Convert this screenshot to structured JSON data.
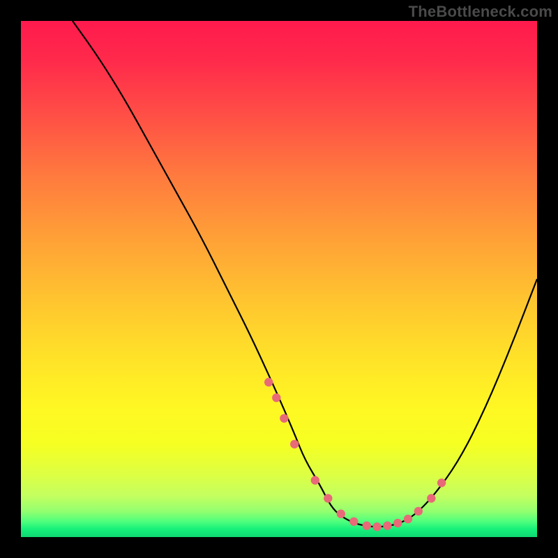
{
  "watermark": "TheBottleneck.com",
  "colors": {
    "page_bg": "#000000",
    "line": "#000000",
    "dot": "#e86a78",
    "gradient_top": "#ff1a4d",
    "gradient_bottom": "#0fd972"
  },
  "chart_data": {
    "type": "line",
    "title": "",
    "xlabel": "",
    "ylabel": "",
    "xlim": [
      0,
      100
    ],
    "ylim": [
      0,
      100
    ],
    "grid": false,
    "legend": false,
    "series": [
      {
        "name": "bottleneck-curve",
        "x": [
          10,
          15,
          20,
          25,
          30,
          35,
          40,
          45,
          50,
          53,
          55,
          58,
          60,
          62,
          65,
          68,
          70,
          73,
          76,
          80,
          85,
          90,
          95,
          100
        ],
        "values": [
          100,
          93,
          85,
          76,
          67,
          58,
          48,
          38,
          27,
          20,
          15,
          10,
          6,
          4,
          2.5,
          2,
          2,
          2.5,
          4,
          8,
          15,
          25,
          37,
          50
        ]
      }
    ],
    "markers": {
      "name": "highlight-dots-near-trough",
      "x": [
        48,
        49.5,
        51,
        53,
        57,
        59.5,
        62,
        64.5,
        67,
        69,
        71,
        73,
        75,
        77,
        79.5,
        81.5
      ],
      "values": [
        30,
        27,
        23,
        18,
        11,
        7.5,
        4.5,
        3,
        2.2,
        2,
        2.2,
        2.7,
        3.5,
        5,
        7.5,
        10.5
      ]
    }
  }
}
